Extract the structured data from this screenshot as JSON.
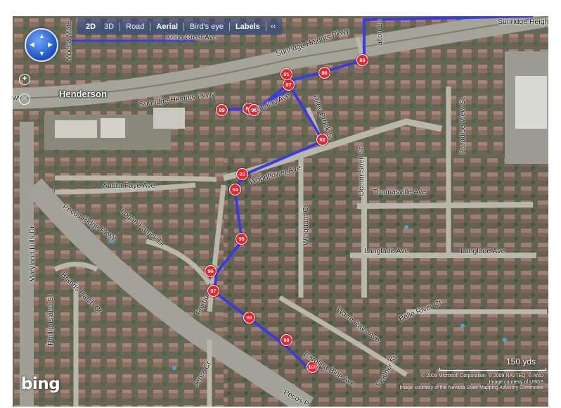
{
  "toolbar": {
    "items": [
      {
        "label": "2D",
        "active": true
      },
      {
        "label": "3D",
        "active": false
      },
      {
        "label": "Road",
        "active": false
      },
      {
        "label": "Aerial",
        "active": true
      },
      {
        "label": "Bird's eye",
        "active": false
      },
      {
        "label": "Labels",
        "active": true
      }
    ],
    "collapse": "‹‹"
  },
  "navigation": {
    "zoom_in": "+",
    "zoom_out": "−",
    "compass_arrows": {
      "up": "▲",
      "down": "▼",
      "left": "◀",
      "right": "▶"
    }
  },
  "place": "Henderson",
  "streets": {
    "sunridge_heights_pkwy_top": "Sunridge Heights Pkwy",
    "sunridge_heights_pkwy_mid": "Sunridge Heights Pkwy",
    "sunridge_heights_pkwy_right": "Sunridge Heigh",
    "kona_crest": "Kona Crest Ave",
    "mocha_mate": "Mocha Mate",
    "alton_ln": "alton Ln",
    "wy": "wy",
    "lilac": "ol Lilac Ave",
    "riley_brook": "Riley Brook St",
    "paradise_view": "Paradise View St",
    "woodflower": "Woodflower Ave",
    "audra_faye": "Audra Faye Ave",
    "logan_patrick": "Logan Patrick Dr",
    "ocean_shell": "Ocean Shell St",
    "thomasville": "Thomasville Ave",
    "wingham": "Wingham Ct",
    "pecos_ridge": "Pecos Ridge Pkwy",
    "maryland_hills": "Maryland Hills Dr",
    "langlade_1": "Langlade Ave",
    "langlade_2": "Langlade Ave",
    "brands_hatch": "Brands Hatch Ct",
    "fairbu": "Fairbu",
    "warm_rays": "Warm Rays Ave",
    "belle_river": "Belle River Ct",
    "phillip_island": "Phillip Island St",
    "carolina_blue": "Carolina Blue Ave",
    "jerez": "Jerez Ct",
    "pecos_p": "Pecos P",
    "feather": "Feather St"
  },
  "route_markers": [
    "85",
    "86",
    "87",
    "89",
    "88",
    "90",
    "91",
    "92",
    "93",
    "94",
    "95",
    "96",
    "97",
    "98",
    "99",
    "100"
  ],
  "colors": {
    "route": "#3b3bdf",
    "marker_fill": "#e8262f",
    "marker_border": "#ffffff",
    "toolbar_bg": "#2a4a9a"
  },
  "scale": {
    "label": "150 yds"
  },
  "brand": "bing",
  "copyright": [
    "© 2009 Microsoft Corporation",
    "© 2009 NAVTEQ",
    "© AND",
    "Image courtesy of USGS",
    "Image courtesy of the Nevada State Mapping Advisory Committee"
  ]
}
